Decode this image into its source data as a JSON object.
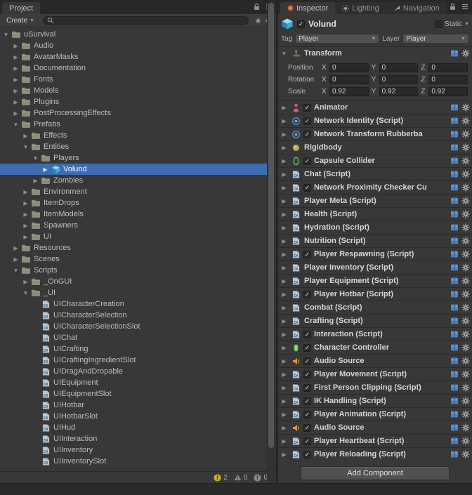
{
  "colors": {
    "selection": "#3D6CB0"
  },
  "project": {
    "tab_label": "Project",
    "toolbar": {
      "create_label": "Create",
      "search_placeholder": ""
    },
    "tree": [
      {
        "label": "uSurvival",
        "level": 0,
        "icon": "folder",
        "arrow": "open"
      },
      {
        "label": "Audio",
        "level": 1,
        "icon": "folder",
        "arrow": "closed"
      },
      {
        "label": "AvatarMasks",
        "level": 1,
        "icon": "folder",
        "arrow": "closed"
      },
      {
        "label": "Documentation",
        "level": 1,
        "icon": "folder",
        "arrow": "closed"
      },
      {
        "label": "Fonts",
        "level": 1,
        "icon": "folder",
        "arrow": "closed"
      },
      {
        "label": "Models",
        "level": 1,
        "icon": "folder",
        "arrow": "closed"
      },
      {
        "label": "Plugins",
        "level": 1,
        "icon": "folder",
        "arrow": "closed"
      },
      {
        "label": "PostProcessingEffects",
        "level": 1,
        "icon": "folder",
        "arrow": "closed"
      },
      {
        "label": "Prefabs",
        "level": 1,
        "icon": "folder",
        "arrow": "open"
      },
      {
        "label": "Effects",
        "level": 2,
        "icon": "folder",
        "arrow": "closed"
      },
      {
        "label": "Entities",
        "level": 2,
        "icon": "folder",
        "arrow": "open"
      },
      {
        "label": "Players",
        "level": 3,
        "icon": "folder",
        "arrow": "open"
      },
      {
        "label": "Volund",
        "level": 4,
        "icon": "prefab",
        "arrow": "closed",
        "selected": true
      },
      {
        "label": "Zombies",
        "level": 3,
        "icon": "folder",
        "arrow": "closed"
      },
      {
        "label": "Environment",
        "level": 2,
        "icon": "folder",
        "arrow": "closed"
      },
      {
        "label": "ItemDrops",
        "level": 2,
        "icon": "folder",
        "arrow": "closed"
      },
      {
        "label": "ItemModels",
        "level": 2,
        "icon": "folder",
        "arrow": "closed"
      },
      {
        "label": "Spawners",
        "level": 2,
        "icon": "folder",
        "arrow": "closed"
      },
      {
        "label": "UI",
        "level": 2,
        "icon": "folder",
        "arrow": "closed"
      },
      {
        "label": "Resources",
        "level": 1,
        "icon": "folder",
        "arrow": "closed"
      },
      {
        "label": "Scenes",
        "level": 1,
        "icon": "folder",
        "arrow": "closed"
      },
      {
        "label": "Scripts",
        "level": 1,
        "icon": "folder",
        "arrow": "open"
      },
      {
        "label": "_OnGUI",
        "level": 2,
        "icon": "folder",
        "arrow": "closed"
      },
      {
        "label": "_UI",
        "level": 2,
        "icon": "folder",
        "arrow": "open"
      },
      {
        "label": "UICharacterCreation",
        "level": 3,
        "icon": "script",
        "arrow": "none"
      },
      {
        "label": "UICharacterSelection",
        "level": 3,
        "icon": "script",
        "arrow": "none"
      },
      {
        "label": "UICharacterSelectionSlot",
        "level": 3,
        "icon": "script",
        "arrow": "none"
      },
      {
        "label": "UIChat",
        "level": 3,
        "icon": "script",
        "arrow": "none"
      },
      {
        "label": "UICrafting",
        "level": 3,
        "icon": "script",
        "arrow": "none"
      },
      {
        "label": "UICraftingIngredientSlot",
        "level": 3,
        "icon": "script",
        "arrow": "none"
      },
      {
        "label": "UIDragAndDropable",
        "level": 3,
        "icon": "script",
        "arrow": "none"
      },
      {
        "label": "UIEquipment",
        "level": 3,
        "icon": "script",
        "arrow": "none"
      },
      {
        "label": "UIEquipmentSlot",
        "level": 3,
        "icon": "script",
        "arrow": "none"
      },
      {
        "label": "UIHotbar",
        "level": 3,
        "icon": "script",
        "arrow": "none"
      },
      {
        "label": "UIHotbarSlot",
        "level": 3,
        "icon": "script",
        "arrow": "none"
      },
      {
        "label": "UIHud",
        "level": 3,
        "icon": "script",
        "arrow": "none"
      },
      {
        "label": "UIInteraction",
        "level": 3,
        "icon": "script",
        "arrow": "none"
      },
      {
        "label": "UIInventory",
        "level": 3,
        "icon": "script",
        "arrow": "none"
      },
      {
        "label": "UIInventorySlot",
        "level": 3,
        "icon": "script",
        "arrow": "none"
      }
    ],
    "status": {
      "error_count": "2",
      "warning_count": "0",
      "info_count": "0"
    }
  },
  "inspector": {
    "tabs": [
      "Inspector",
      "Lighting",
      "Navigation"
    ],
    "header": {
      "name": "Volund",
      "active": true,
      "static_label": "Static",
      "static_checked": false,
      "tag_label": "Tag",
      "tag_value": "Player",
      "layer_label": "Layer",
      "layer_value": "Player"
    },
    "transform": {
      "title": "Transform",
      "axis_labels": [
        "X",
        "Y",
        "Z"
      ],
      "rows": [
        {
          "label": "Position",
          "values": [
            "0",
            "0",
            "0"
          ]
        },
        {
          "label": "Rotation",
          "values": [
            "0",
            "0",
            "0"
          ]
        },
        {
          "label": "Scale",
          "values": [
            "0.92",
            "0.92",
            "0.92"
          ]
        }
      ]
    },
    "components": [
      {
        "name": "Animator",
        "icon": "animator",
        "toggle": true
      },
      {
        "name": "Network Identity (Script)",
        "icon": "network",
        "toggle": true
      },
      {
        "name": "Network Transform Rubberba",
        "icon": "network",
        "toggle": true
      },
      {
        "name": "Rigidbody",
        "icon": "rigidbody",
        "toggle": false
      },
      {
        "name": "Capsule Collider",
        "icon": "capsule",
        "toggle": true
      },
      {
        "name": "Chat (Script)",
        "icon": "script",
        "toggle": false
      },
      {
        "name": "Network Proximity Checker Cu",
        "icon": "script",
        "toggle": true
      },
      {
        "name": "Player Meta (Script)",
        "icon": "script",
        "toggle": false
      },
      {
        "name": "Health (Script)",
        "icon": "script",
        "toggle": false
      },
      {
        "name": "Hydration (Script)",
        "icon": "script",
        "toggle": false
      },
      {
        "name": "Nutrition (Script)",
        "icon": "script",
        "toggle": false
      },
      {
        "name": "Player Respawning (Script)",
        "icon": "script",
        "toggle": true
      },
      {
        "name": "Player Inventory (Script)",
        "icon": "script",
        "toggle": false
      },
      {
        "name": "Player Equipment (Script)",
        "icon": "script",
        "toggle": false
      },
      {
        "name": "Player Hotbar (Script)",
        "icon": "script",
        "toggle": true
      },
      {
        "name": "Combat (Script)",
        "icon": "script",
        "toggle": false
      },
      {
        "name": "Crafting (Script)",
        "icon": "script",
        "toggle": false
      },
      {
        "name": "Interaction (Script)",
        "icon": "script",
        "toggle": true
      },
      {
        "name": "Character Controller",
        "icon": "charctrl",
        "toggle": true
      },
      {
        "name": "Audio Source",
        "icon": "audio",
        "toggle": true
      },
      {
        "name": "Player Movement (Script)",
        "icon": "script",
        "toggle": true
      },
      {
        "name": "First Person Clipping (Script)",
        "icon": "script",
        "toggle": true
      },
      {
        "name": "IK Handling (Script)",
        "icon": "script",
        "toggle": true
      },
      {
        "name": "Player Animation (Script)",
        "icon": "script",
        "toggle": true
      },
      {
        "name": "Audio Source",
        "icon": "audio",
        "toggle": true
      },
      {
        "name": "Player Heartbeat (Script)",
        "icon": "script",
        "toggle": true
      },
      {
        "name": "Player Reloading (Script)",
        "icon": "script",
        "toggle": true
      }
    ],
    "add_component_label": "Add Component"
  }
}
